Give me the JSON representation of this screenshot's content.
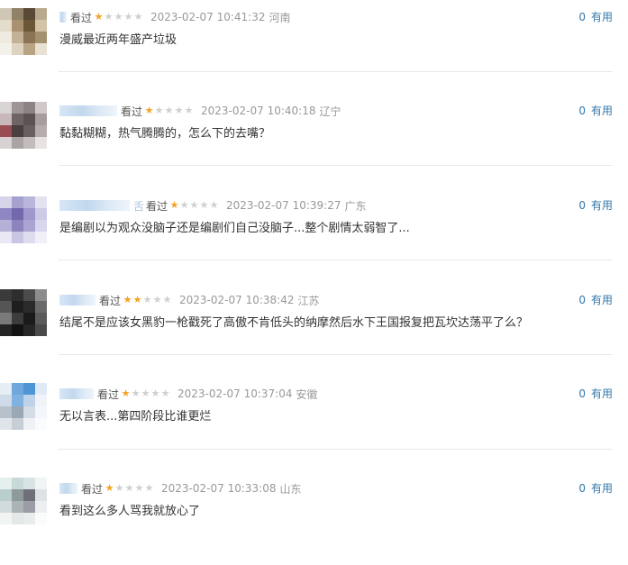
{
  "reviews": [
    {
      "user_suffix": "Ŋ",
      "watched_label": "看过",
      "stars": 1,
      "date": "2023-02-07 10:41:32",
      "location": "河南",
      "comment": "漫威最近两年盛产垃圾",
      "useful_count": "0",
      "useful_label": "有用"
    },
    {
      "user_suffix": "",
      "watched_label": "看过",
      "stars": 1,
      "date": "2023-02-07 10:40:18",
      "location": "辽宁",
      "comment": "黏黏糊糊，热气腾腾的，怎么下的去嘴？",
      "useful_count": "0",
      "useful_label": "有用"
    },
    {
      "user_suffix": "舌",
      "watched_label": "看过",
      "stars": 1,
      "date": "2023-02-07 10:39:27",
      "location": "广东",
      "comment": "是编剧以为观众没脑子还是编剧们自己没脑子...整个剧情太弱智了...",
      "useful_count": "0",
      "useful_label": "有用"
    },
    {
      "user_suffix": "",
      "watched_label": "看过",
      "stars": 2,
      "date": "2023-02-07 10:38:42",
      "location": "江苏",
      "comment": "结尾不是应该女黑豹一枪戳死了高傲不肯低头的纳摩然后水下王国报复把瓦坎达荡平了么？",
      "useful_count": "0",
      "useful_label": "有用"
    },
    {
      "user_suffix": "",
      "watched_label": "看过",
      "stars": 1,
      "date": "2023-02-07 10:37:04",
      "location": "安徽",
      "comment": "无以言表...第四阶段比谁更烂",
      "useful_count": "0",
      "useful_label": "有用"
    },
    {
      "user_suffix": "",
      "watched_label": "看过",
      "stars": 1,
      "date": "2023-02-07 10:33:08",
      "location": "山东",
      "comment": "看到这么多人骂我就放心了",
      "useful_count": "0",
      "useful_label": "有用"
    }
  ],
  "colors": {
    "star_on": "#f3a323",
    "star_off": "#cfcfcf",
    "useful_link": "#3377aa",
    "comment_text": "#333333",
    "meta_text": "#999999"
  }
}
